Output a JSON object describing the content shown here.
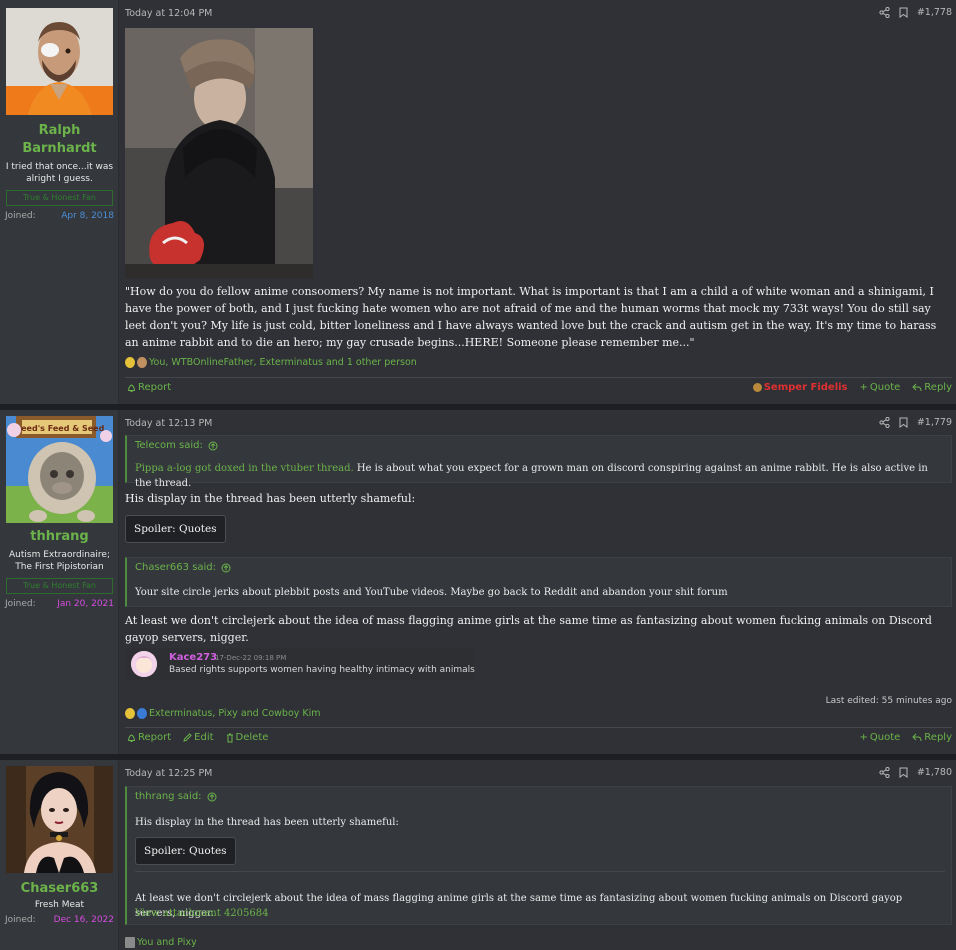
{
  "posts": [
    {
      "user": {
        "name_line1": "Ralph",
        "name_line2": "Barnhardt",
        "title": "I tried that once...it was alright I guess.",
        "banner": "True & Honest Fan",
        "joined_label": "Joined:",
        "joined_date": "Apr 8, 2018",
        "joined_color": "#4c8fd6"
      },
      "date": "Today at 12:04 PM",
      "post_number": "#1,778",
      "body": "\"How do you do fellow anime consoomers? My name is not important. What is important is that I am a child a of white woman and a shinigami, I have the power of both, and I just fucking hate women who are not afraid of me and the human worms that mock my 733t ways! You do still say leet don't you? My life is just cold, bitter loneliness and I have always wanted love but the crack and autism get in the way. It's my time to harass an anime rabbit and to die an hero; my gay crusade begins...HERE! Someone please remember me...\"",
      "reactions": "You, WTBOnlineFather, Exterminatus and 1 other person",
      "footer": {
        "report": "Report",
        "flair_name": "Semper Fidelis",
        "quote": "Quote",
        "reply": "Reply"
      }
    },
    {
      "user": {
        "name": "thhrang",
        "title": "Autism Extraordinaire; The First Pipistorian",
        "banner": "True & Honest Fan",
        "joined_label": "Joined:",
        "joined_date": "Jan 20, 2021",
        "joined_color": "#d64ce0"
      },
      "date": "Today at 12:13 PM",
      "post_number": "#1,779",
      "quote1": {
        "author": "Telecom said:",
        "green_part": "Pippa a-log got doxed in the vtuber thread.",
        "rest": " He is about what you expect for a grown man on discord conspiring against an anime rabbit. He is also active in the thread."
      },
      "line1": "His display in the thread has been utterly shameful:",
      "spoiler": "Spoiler: Quotes",
      "quote2": {
        "author": "Chaser663 said:",
        "text": "Your site circle jerks about plebbit posts and YouTube videos. Maybe go back to Reddit and abandon your shit forum"
      },
      "line2": "At least we don't circlejerk about the idea of mass flagging anime girls at the same time as fantasizing about women fucking animals on Discord gayop servers, nigger.",
      "discord": {
        "name": "Kace273",
        "time": "17-Dec-22 09:18 PM",
        "text": "Based rights supports women having healthy intimacy with animals"
      },
      "edited": "Last edited: 55 minutes ago",
      "reactions": "Exterminatus, Pixy and Cowboy Kim",
      "footer": {
        "report": "Report",
        "edit": "Edit",
        "delete": "Delete",
        "quote": "Quote",
        "reply": "Reply"
      }
    },
    {
      "user": {
        "name": "Chaser663",
        "title": "Fresh Meat",
        "joined_label": "Joined:",
        "joined_date": "Dec 16, 2022",
        "joined_color": "#d64ce0"
      },
      "date": "Today at 12:25 PM",
      "post_number": "#1,780",
      "quote": {
        "author": "thhrang said:",
        "line1": "His display in the thread has been utterly shameful:",
        "spoiler": "Spoiler: Quotes",
        "line2": "At least we don't circlejerk about the idea of mass flagging anime girls at the same time as fantasizing about women fucking animals on Discord gayop servers, nigger.",
        "attachment": "View attachment 4205684"
      },
      "reactions": "You and Pixy"
    }
  ],
  "colors": {
    "accent_green": "#6bb34a",
    "flair_red": "#e03030",
    "post_bg": "#2f3136",
    "user_bg": "#34373c"
  }
}
